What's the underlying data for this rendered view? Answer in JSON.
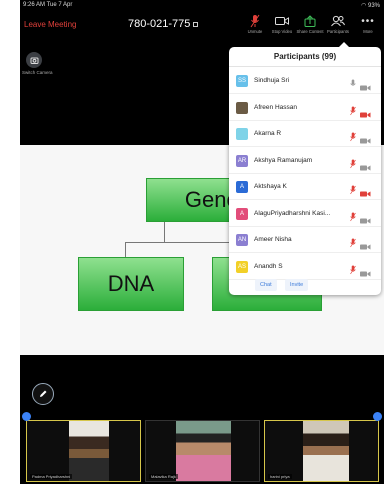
{
  "status_bar": {
    "time": "9:26 AM  Tue 7 Apr",
    "battery": "93%"
  },
  "toolbar": {
    "leave_label": "Leave Meeting",
    "meeting_id": "780-021-775",
    "tools": [
      {
        "label": "Unmute",
        "icon": "mic-muted-icon"
      },
      {
        "label": "Stop Video",
        "icon": "video-camera-icon"
      },
      {
        "label": "Share Content",
        "icon": "share-screen-icon"
      },
      {
        "label": "Participants",
        "icon": "participants-icon"
      },
      {
        "label": "More",
        "icon": "more-dots-icon"
      }
    ]
  },
  "switch_camera_label": "Switch Camera",
  "slide": {
    "title": "Genom",
    "left_box": "DNA"
  },
  "participants": {
    "title": "Participants (99)",
    "list": [
      {
        "name": "Sindhuja Sri",
        "initials": "SS",
        "avatar_color": "#67c0ea",
        "mic": "on",
        "video": "off"
      },
      {
        "name": "Afreen Hassan",
        "initials": "",
        "avatar_color": "#6b5b45",
        "mic": "muted",
        "video": "off-red"
      },
      {
        "name": "Akarna R",
        "initials": "",
        "avatar_color": "#7fd3e8",
        "mic": "muted",
        "video": "off"
      },
      {
        "name": "Akshya Ramanujam",
        "initials": "AR",
        "avatar_color": "#8b7fd1",
        "mic": "muted",
        "video": "off"
      },
      {
        "name": "Aktshaya K",
        "initials": "A",
        "avatar_color": "#2b6bd6",
        "mic": "muted",
        "video": "off-red"
      },
      {
        "name": "AlaguPriyadharshni Kasi...",
        "initials": "A",
        "avatar_color": "#e24d7a",
        "mic": "muted",
        "video": "off"
      },
      {
        "name": "Ameer Nisha",
        "initials": "AN",
        "avatar_color": "#8b7fd1",
        "mic": "muted",
        "video": "off"
      },
      {
        "name": "Anandh S",
        "initials": "AS",
        "avatar_color": "#f2d028",
        "mic": "muted",
        "video": "off"
      }
    ],
    "chat_label": "Chat",
    "invite_label": "Invite"
  },
  "thumbnails": [
    {
      "name": "Padma Priyadharshni"
    },
    {
      "name": "Malavika Rajk"
    },
    {
      "name": "harini priya"
    }
  ],
  "colors": {
    "leave": "#e0403a",
    "muted_red": "#e0403a",
    "accent": "#3b82f6",
    "slide_box": "#2bae3a"
  }
}
